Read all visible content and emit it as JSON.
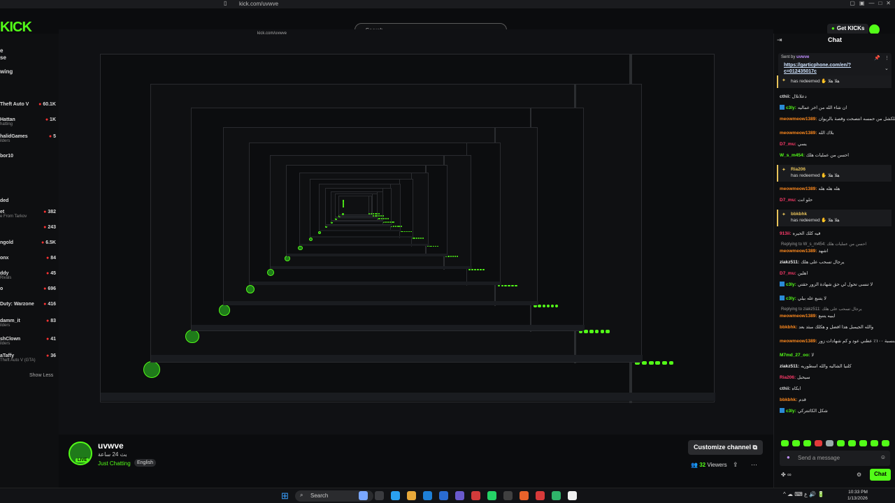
{
  "browser": {
    "url": "kick.com/uvwve"
  },
  "header": {
    "logo": "KICK",
    "search_placeholder": "Search",
    "get_kicks": "Get KICKs"
  },
  "sidebar": {
    "items": [
      {
        "label": "e"
      },
      {
        "label": "se"
      },
      {
        "label": "wing"
      },
      {
        "label": "Theft Auto V",
        "value": "60.1K"
      },
      {
        "label": "Hattan",
        "value": "1K",
        "sub": "hatting"
      },
      {
        "label": "halidGames",
        "value": "5",
        "sub": "ilders"
      },
      {
        "label": "bor10"
      },
      {
        "label": "ded"
      },
      {
        "label": "et",
        "value": "382",
        "sub": "e From Tarkov"
      },
      {
        "label": "",
        "value": "243"
      },
      {
        "label": "ngold",
        "value": "6.5K"
      },
      {
        "label": "onx",
        "value": "84"
      },
      {
        "label": "ddy",
        "value": "45",
        "sub": "Rivals"
      },
      {
        "label": "o",
        "value": "696"
      },
      {
        "label": "Duty: Warzone",
        "value": "416"
      },
      {
        "label": "damm_it",
        "value": "83",
        "sub": "ilders"
      },
      {
        "label": "shClown",
        "value": "41",
        "sub": "ilders"
      },
      {
        "label": "aTaffy",
        "value": "36",
        "sub": "Theft Auto V (GTA)"
      }
    ],
    "show_less": "Show Less"
  },
  "channel": {
    "name": "uvwve",
    "status": "بث 24 ساعة",
    "category": "Just Chatting",
    "language": "English",
    "live_badge": "LIVE",
    "customize": "Customize channel",
    "viewers_count": "32",
    "viewers_label": "Viewers"
  },
  "chat": {
    "title": "Chat",
    "pinned": {
      "sent_by": "Sent by",
      "user": "uvwve",
      "link": "https://garticphone.com/en/?c=012435017c"
    },
    "messages": [
      {
        "type": "redeem",
        "user": "",
        "text": "has redeemed ✋ هلا هلا"
      },
      {
        "type": "msg",
        "user": "cthii:",
        "color": "#ddd",
        "text": "دعلاتلال"
      },
      {
        "type": "msg",
        "user": "c3ly:",
        "color": "#53fc18",
        "badge": true,
        "text": "ان شاء الله من اخر عماليه"
      },
      {
        "type": "msg",
        "user": "meowmeow1389:",
        "color": "#ff8a1e",
        "text": "كلكشل من حمسه انتصحت وقصة بالريوان"
      },
      {
        "type": "msg",
        "user": "meowmeow1389:",
        "color": "#ff8a1e",
        "text": "بلاك الله"
      },
      {
        "type": "msg",
        "user": "D7_mu:",
        "color": "#ff3a6a",
        "text": "يسي"
      },
      {
        "type": "msg",
        "user": "W_s_m454:",
        "color": "#53fc18",
        "text": "احسن من عمليات هلك"
      },
      {
        "type": "redeem",
        "user": "Ria206",
        "text": "has redeemed ✋ هلا هلا"
      },
      {
        "type": "msg",
        "user": "meowmeow1389:",
        "color": "#ff8a1e",
        "text": "هله هله هله"
      },
      {
        "type": "msg",
        "user": "D7_mu:",
        "color": "#ff3a6a",
        "text": "حلو انت"
      },
      {
        "type": "redeem",
        "user": "bbkbhk",
        "text": "has redeemed ✋ هلا هلا"
      },
      {
        "type": "msg",
        "user": "913ii:",
        "color": "#ff3a6a",
        "text": "فيه كلك الحيره"
      },
      {
        "type": "reply",
        "text": "Replying to W_s_m454: احسن من عمليات هلك"
      },
      {
        "type": "msg",
        "user": "meowmeow1389:",
        "color": "#ff8a1e",
        "text": "اشهد"
      },
      {
        "type": "msg",
        "user": "ziakz511:",
        "color": "#e8e8e8",
        "text": "يرجال تسحب على هلك"
      },
      {
        "type": "msg",
        "user": "D7_mu:",
        "color": "#ff3a6a",
        "text": "اهلين"
      },
      {
        "type": "msg",
        "user": "c3ly:",
        "color": "#53fc18",
        "badge": true,
        "text": "لا تنسى تحول لي حق شهادة الزور حقتي"
      },
      {
        "type": "msg",
        "user": "c3ly:",
        "color": "#53fc18",
        "badge": true,
        "text": "لا يتنبع عله بيلي"
      },
      {
        "type": "reply",
        "text": "Replying to ziakz511: يرجال تسحب على هلك"
      },
      {
        "type": "msg",
        "user": "meowmeow1389:",
        "color": "#ff8a1e",
        "text": "ايبيه يتنبع"
      },
      {
        "type": "msg",
        "user": "bbkbhk:",
        "color": "#ff8a1e",
        "text": "والله الجيمبل هذا افضل و هكلك مبثد بعد"
      },
      {
        "type": "msg",
        "user": "meowmeow1389:",
        "color": "#ff8a1e",
        "text": "والله انا صادق بنسبة ١٠٠٪ عطني عود و كم شهادات زور"
      },
      {
        "type": "msg",
        "user": "M7md_27_oo:",
        "color": "#53fc18",
        "text": "لا"
      },
      {
        "type": "msg",
        "user": "ziakz511:",
        "color": "#e8e8e8",
        "text": "كلنيا الشاليه والله اسطوريه"
      },
      {
        "type": "msg",
        "user": "Ria206:",
        "color": "#ff3a6a",
        "text": "سيحبل"
      },
      {
        "type": "msg",
        "user": "cthii:",
        "color": "#ddd",
        "text": "ابكاه"
      },
      {
        "type": "msg",
        "user": "bbkbhk:",
        "color": "#ff8a1e",
        "text": "قدم"
      },
      {
        "type": "msg",
        "user": "c3ly:",
        "color": "#53fc18",
        "badge": true,
        "text": "شكل الكائنتركي"
      }
    ],
    "input_placeholder": "Send a message",
    "send_label": "Chat",
    "footer_left": "∞"
  },
  "taskbar": {
    "search": "Search",
    "time": "10:33 PM",
    "date": "1/13/2026",
    "tray": "^ ☁ ⌨ ع 🔊 🔋"
  },
  "colors": {
    "accent": "#53fc18",
    "background": "#0b0c0e"
  }
}
